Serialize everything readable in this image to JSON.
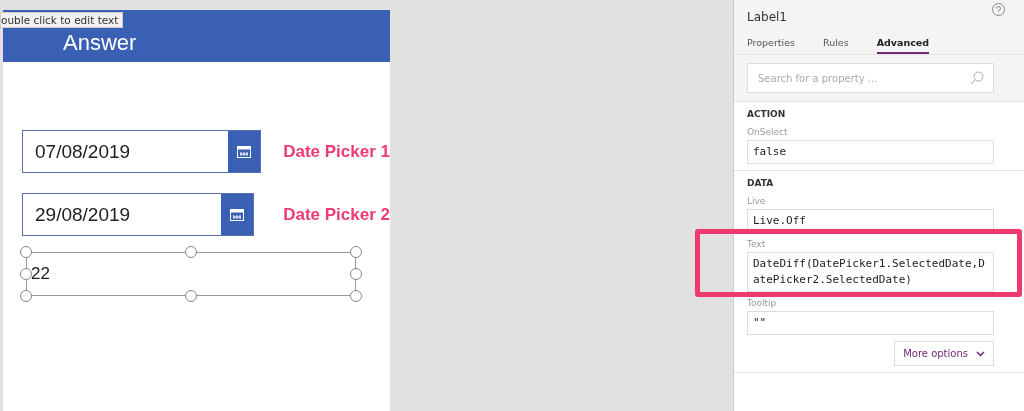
{
  "canvas": {
    "screen_title": "Answer",
    "hover_tooltip": "ouble click to edit text",
    "date_pickers": [
      {
        "value": "07/08/2019",
        "annotation": "Date Picker 1"
      },
      {
        "value": "29/08/2019",
        "annotation": "Date Picker 2"
      }
    ],
    "label": {
      "value": "22",
      "selected": true
    }
  },
  "panel": {
    "title": "Label1",
    "tabs": [
      {
        "label": "Properties",
        "selected": false
      },
      {
        "label": "Rules",
        "selected": false
      },
      {
        "label": "Advanced",
        "selected": true
      }
    ],
    "search": {
      "placeholder": "Search for a property ..."
    },
    "sections": [
      {
        "heading": "ACTION",
        "properties": [
          {
            "name": "OnSelect",
            "value": "false",
            "highlighted": false
          }
        ]
      },
      {
        "heading": "DATA",
        "properties": [
          {
            "name": "Live",
            "value": "Live.Off",
            "highlighted": false
          },
          {
            "name": "Text",
            "value": "DateDiff(DatePicker1.SelectedDate,DatePicker2.SelectedDate)",
            "highlighted": true
          },
          {
            "name": "Tooltip",
            "value": "\"\"",
            "highlighted": false
          }
        ]
      }
    ],
    "more_button": "More options"
  }
}
